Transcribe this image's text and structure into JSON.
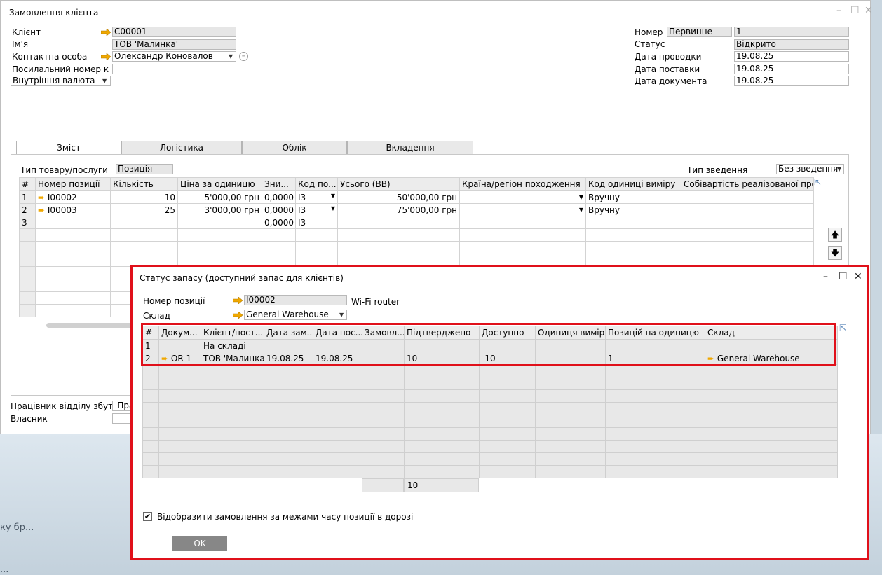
{
  "window": {
    "title": "Замовлення клієнта"
  },
  "header_left": {
    "client_label": "Клієнт",
    "client_value": "C00001",
    "name_label": "Ім'я",
    "name_value": "ТОВ 'Малинка'",
    "contact_label": "Контактна особа",
    "contact_value": "Олександр Коновалов",
    "ref_label": "Посилальний номер к",
    "currency_value": "Внутрішня валюта"
  },
  "header_right": {
    "number_label": "Номер",
    "series_value": "Первинне",
    "number_value": "1",
    "status_label": "Статус",
    "status_value": "Відкрито",
    "posting_label": "Дата проводки",
    "posting_value": "19.08.25",
    "delivery_label": "Дата поставки",
    "delivery_value": "19.08.25",
    "doc_label": "Дата документа",
    "doc_value": "19.08.25"
  },
  "tabs": [
    "Зміст",
    "Логістика",
    "Облік",
    "Вкладення"
  ],
  "content": {
    "item_type_label": "Тип товару/послуги",
    "item_type_value": "Позиція",
    "summary_label": "Тип зведення",
    "summary_value": "Без зведення",
    "columns": [
      "#",
      "Номер позиції",
      "Кількість",
      "Ціна за одиницю",
      "Зни...",
      "Код по...",
      "Усього (ВВ)",
      "Країна/регіон походження",
      "Код одиниці виміру",
      "Собівартість реалізованої про..."
    ],
    "rows": [
      {
        "n": "1",
        "item": "I00002",
        "qty": "10",
        "price": "5'000,00 грн",
        "disc": "0,0000",
        "tax": "I3",
        "total": "50'000,00 грн",
        "country": "",
        "uom": "Вручну",
        "cogs": ""
      },
      {
        "n": "2",
        "item": "I00003",
        "qty": "25",
        "price": "3'000,00 грн",
        "disc": "0,0000",
        "tax": "I3",
        "total": "75'000,00 грн",
        "country": "",
        "uom": "Вручну",
        "cogs": ""
      },
      {
        "n": "3",
        "item": "",
        "qty": "",
        "price": "",
        "disc": "0,0000",
        "tax": "I3",
        "total": "",
        "country": "",
        "uom": "",
        "cogs": ""
      }
    ]
  },
  "footer": {
    "sales_employee_label": "Працівник відділу збут",
    "sales_employee_value": "-Пра",
    "owner_label": "Власник"
  },
  "background": {
    "text1": "ку бр...",
    "text2": "..."
  },
  "dialog": {
    "title": "Статус запасу (доступний запас для клієнтів)",
    "item_label": "Номер позиції",
    "item_value": "I00002",
    "item_desc": "Wi-Fi router",
    "warehouse_label": "Склад",
    "warehouse_value": "General Warehouse",
    "columns": [
      "#",
      "Докум...",
      "Клієнт/пост...",
      "Дата зам...",
      "Дата пос...",
      "Замовл...",
      "Підтверджено",
      "Доступно",
      "Одиниця виміру",
      "Позицій на одиницю",
      "Склад"
    ],
    "rows": [
      {
        "n": "1",
        "doc": "",
        "client": "На складі",
        "d1": "",
        "d2": "",
        "ordered": "",
        "confirmed": "",
        "available": "",
        "uom": "",
        "per_unit": "",
        "wh": ""
      },
      {
        "n": "2",
        "doc": "OR 1",
        "client": "ТОВ 'Малинка'",
        "d1": "19.08.25",
        "d2": "19.08.25",
        "ordered": "",
        "confirmed": "10",
        "available": "-10",
        "uom": "",
        "per_unit": "1",
        "wh": "General Warehouse"
      }
    ],
    "total_confirmed": "10",
    "checkbox_label": "Відобразити замовлення за межами часу позиції в дорозі",
    "ok_label": "OK"
  },
  "colors": {
    "highlight": "#e0101a",
    "link_arrow": "#f0a800"
  }
}
